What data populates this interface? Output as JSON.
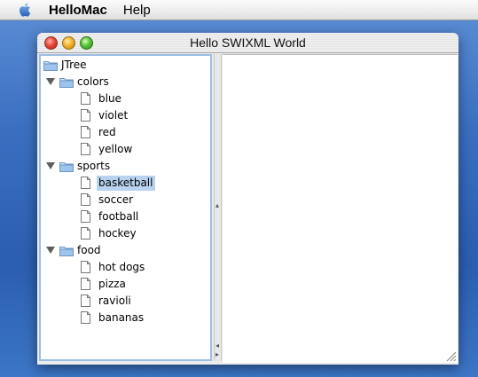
{
  "menubar": {
    "app_name": "HelloMac",
    "help": "Help",
    "apple_icon": "apple-icon"
  },
  "window": {
    "title": "Hello SWIXML World"
  },
  "tree": {
    "root": "JTree",
    "groups": [
      {
        "label": "colors",
        "expanded": true,
        "items": [
          "blue",
          "violet",
          "red",
          "yellow"
        ]
      },
      {
        "label": "sports",
        "expanded": true,
        "items": [
          "basketball",
          "soccer",
          "football",
          "hockey"
        ]
      },
      {
        "label": "food",
        "expanded": true,
        "items": [
          "hot dogs",
          "pizza",
          "ravioli",
          "bananas"
        ]
      }
    ],
    "selected": "basketball"
  },
  "colors": {
    "selection": "#b8d2f0",
    "tree_border": "#9dbde3",
    "desktop": "#3a6fc0"
  }
}
